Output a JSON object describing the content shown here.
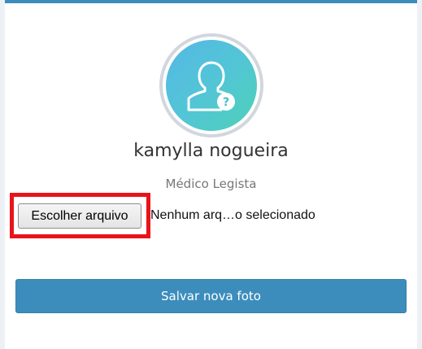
{
  "profile": {
    "name": "kamylla nogueira",
    "role": "Médico Legista",
    "avatar_icon": "user-question-icon"
  },
  "upload": {
    "choose_file_label": "Escolher arquivo",
    "file_status": "Nenhum arq…o selecionado"
  },
  "actions": {
    "save_photo_label": "Salvar nova foto"
  },
  "colors": {
    "primary": "#3c8dbc",
    "highlight": "#e8141a",
    "avatar_gradient_start": "#56b7e6",
    "avatar_gradient_end": "#4fd1b8"
  }
}
